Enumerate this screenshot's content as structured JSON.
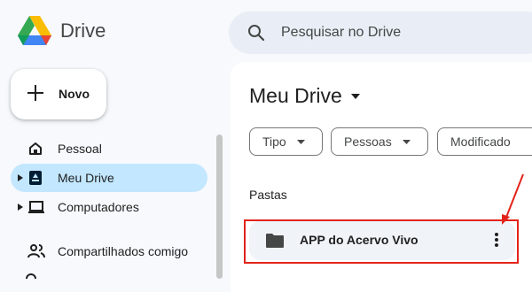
{
  "app": {
    "name": "Drive"
  },
  "search": {
    "placeholder": "Pesquisar no Drive",
    "icon": "search-icon"
  },
  "new_button": {
    "label": "Novo"
  },
  "sidebar": {
    "items": [
      {
        "label": "Pessoal",
        "icon": "home-icon",
        "active": false,
        "expandable": false
      },
      {
        "label": "Meu Drive",
        "icon": "my-drive-icon",
        "active": true,
        "expandable": true
      },
      {
        "label": "Computadores",
        "icon": "computer-icon",
        "active": false,
        "expandable": true
      },
      {
        "label": "Compartilhados comigo",
        "icon": "shared-people-icon",
        "active": false,
        "expandable": false
      }
    ]
  },
  "main": {
    "title": "Meu Drive",
    "filters": [
      {
        "label": "Tipo"
      },
      {
        "label": "Pessoas"
      },
      {
        "label": "Modificado"
      }
    ],
    "folders_heading": "Pastas",
    "folders": [
      {
        "name": "APP do Acervo Vivo"
      }
    ]
  },
  "colors": {
    "accent_active": "#c2e7ff",
    "search_bg": "#e9eef6",
    "annotation_red": "#e2231a"
  }
}
